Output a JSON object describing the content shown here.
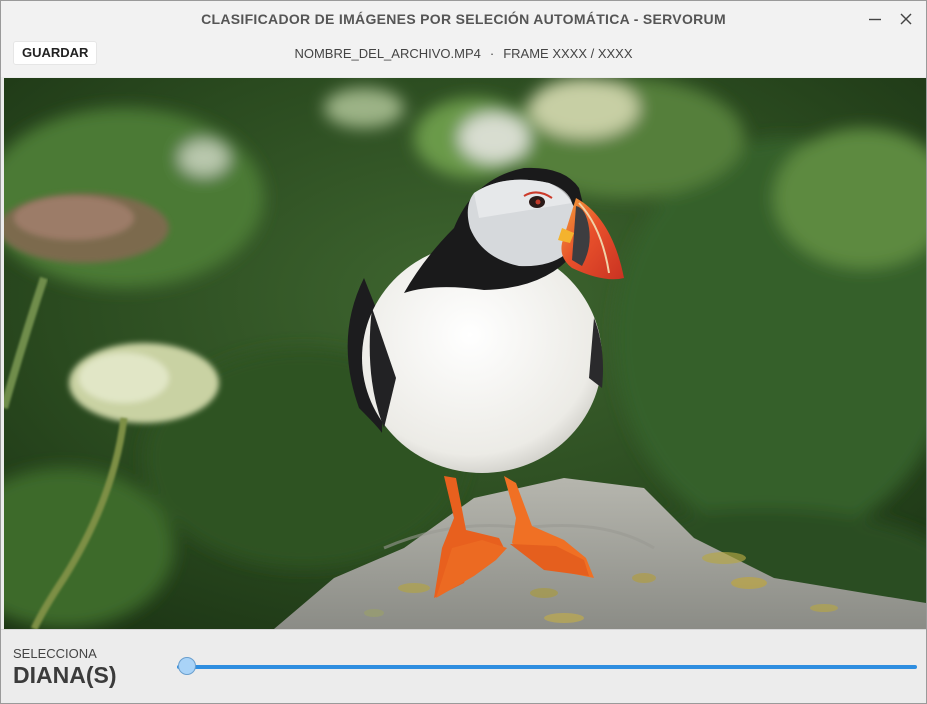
{
  "window": {
    "title": "CLASIFICADOR DE IMÁGENES POR SELECIÓN AUTOMÁTICA - SERVORUM"
  },
  "toolbar": {
    "save_label": "GUARDAR",
    "filename": "NOMBRE_DEL_ARCHIVO.MP4",
    "separator": "·",
    "frame_label": "FRAME XXXX / XXXX"
  },
  "viewer": {
    "subject": "puffin-on-rock"
  },
  "selector": {
    "label": "SELECCIONA",
    "value": "DIANA(S)",
    "slider_position": 0
  },
  "colors": {
    "accent": "#2f8ee0",
    "thumb": "#a9d3f7",
    "title_text": "#555555"
  },
  "icons": {
    "minimize": "minimize-icon",
    "close": "close-icon"
  }
}
